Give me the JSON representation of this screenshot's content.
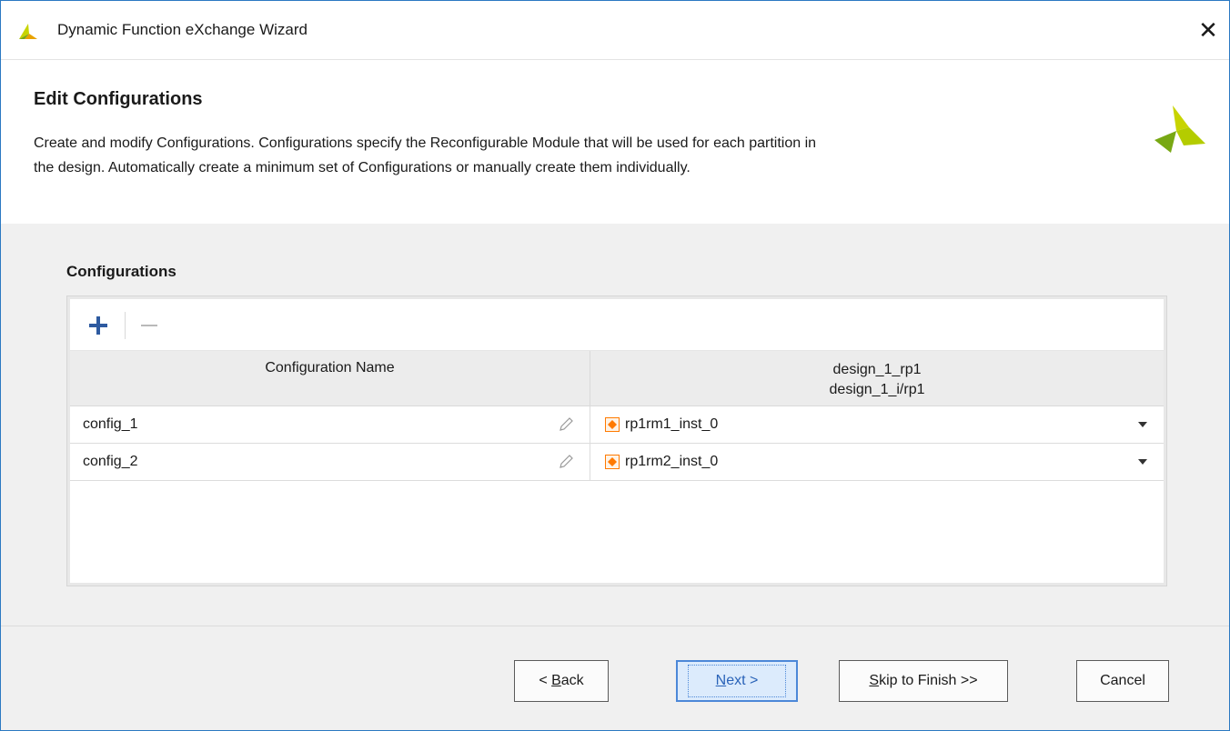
{
  "window": {
    "title": "Dynamic Function eXchange Wizard",
    "close_glyph": "✕"
  },
  "header": {
    "title": "Edit Configurations",
    "description_line1": "Create and modify Configurations. Configurations specify the Reconfigurable Module that will be used for each partition in",
    "description_line2": "the design. Automatically create a minimum set of Configurations or manually create them individually."
  },
  "configurations": {
    "label": "Configurations",
    "toolbar": {
      "add_icon": "plus-icon",
      "remove_icon": "minus-icon"
    },
    "columns": {
      "name": "Configuration Name",
      "partition_line1": "design_1_rp1",
      "partition_line2": "design_1_i/rp1"
    },
    "rows": [
      {
        "name": "config_1",
        "module": "rp1rm1_inst_0"
      },
      {
        "name": "config_2",
        "module": "rp1rm2_inst_0"
      }
    ]
  },
  "buttons": {
    "back_mnemonic": "B",
    "back_prefix": "< ",
    "back_rest": "ack",
    "next_mnemonic": "N",
    "next_rest": "ext >",
    "skip_mnemonic": "S",
    "skip_rest": "kip to Finish >>",
    "cancel": "Cancel"
  },
  "colors": {
    "accent": "#4c88d8",
    "logo_yellow": "#c8d400",
    "logo_green": "#78a814",
    "module_icon": "#ff7a00"
  }
}
